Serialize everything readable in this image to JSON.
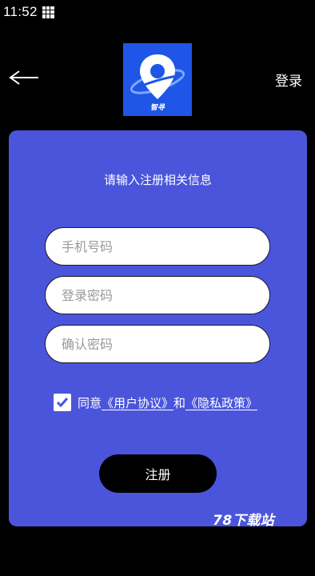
{
  "status_bar": {
    "time": "11:52",
    "grid_icon": "apps-grid-icon"
  },
  "header": {
    "back_icon": "arrow-left-icon",
    "logo_icon": "location-pin-icon",
    "logo_caption": "智寻",
    "login_label": "登录"
  },
  "form": {
    "title": "请输入注册相关信息",
    "phone_placeholder": "手机号码",
    "password_placeholder": "登录密码",
    "confirm_placeholder": "确认密码",
    "agree_prefix": "同意",
    "user_agreement": "《用户协议》",
    "agree_and": "和",
    "privacy_policy": "《隐私政策》",
    "agreed": true,
    "register_label": "注册"
  },
  "watermark": "78下载站",
  "colors": {
    "background": "#000000",
    "card": "#4a55dc",
    "logo_bg": "#1f56e8",
    "button": "#000000"
  }
}
